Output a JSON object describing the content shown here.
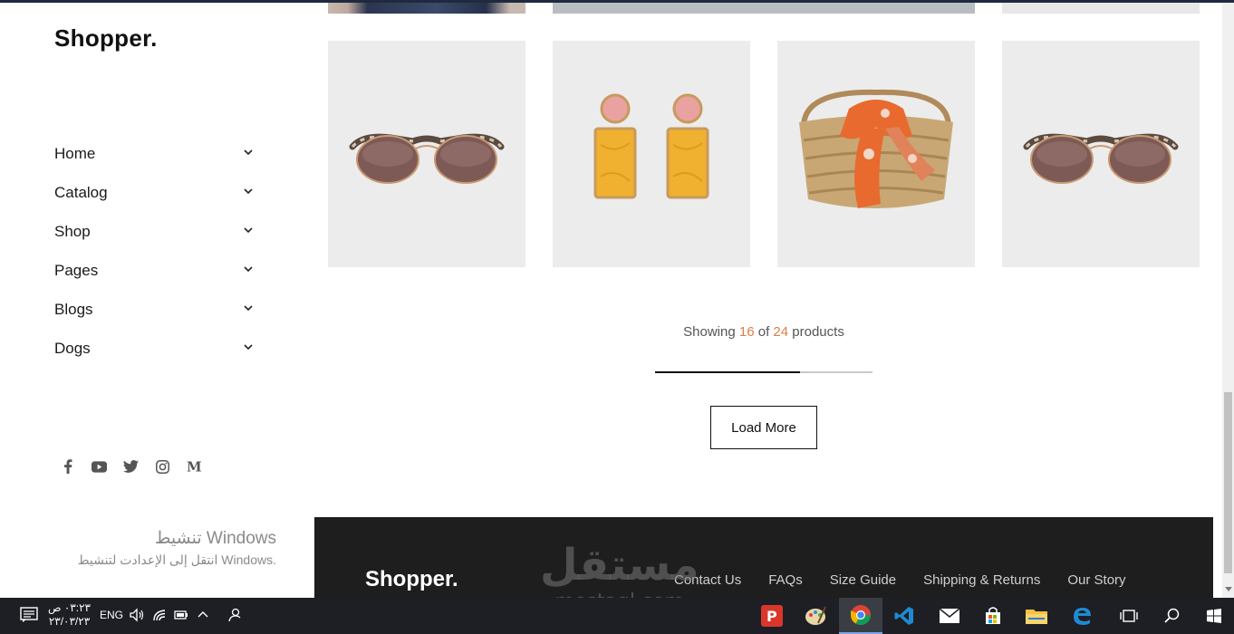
{
  "brand": {
    "name": "Shopper."
  },
  "sidebar": {
    "nav": [
      {
        "label": "Home"
      },
      {
        "label": "Catalog"
      },
      {
        "label": "Shop"
      },
      {
        "label": "Pages"
      },
      {
        "label": "Blogs"
      },
      {
        "label": "Dogs"
      }
    ],
    "social": [
      "facebook-icon",
      "youtube-icon",
      "twitter-icon",
      "instagram-icon",
      "medium-icon"
    ]
  },
  "products": [
    {
      "image": "sunglasses"
    },
    {
      "image": "earrings"
    },
    {
      "image": "straw-bag-with-scarf"
    },
    {
      "image": "sunglasses"
    }
  ],
  "pagination": {
    "prefix": "Showing",
    "shown": "16",
    "middle": "of",
    "total": "24",
    "suffix": "products",
    "progress_fraction": 0.667,
    "load_more_label": "Load More"
  },
  "footer": {
    "brand": "Shopper.",
    "links": [
      "Contact Us",
      "FAQs",
      "Size Guide",
      "Shipping & Returns",
      "Our Story"
    ]
  },
  "windows_activation": {
    "title": "تنشيط Windows",
    "subtitle": "انتقل إلى الإعدادت لتنشيط Windows."
  },
  "watermark": {
    "arabic": "مستقل",
    "latin": "mostaql.com"
  },
  "taskbar": {
    "time": "٠٣:٢٣ ص",
    "date": "٢٣/٠٣/٢٣",
    "language": "ENG",
    "apps": [
      "pinterest-icon",
      "paint-icon",
      "chrome-icon",
      "vscode-icon",
      "mail-icon",
      "store-icon",
      "file-explorer-icon",
      "edge-icon",
      "task-view-icon",
      "search-icon",
      "start-icon"
    ]
  },
  "colors": {
    "accent": "#e07d45",
    "footer_bg": "#1e1e1e",
    "card_bg": "#ececec"
  }
}
